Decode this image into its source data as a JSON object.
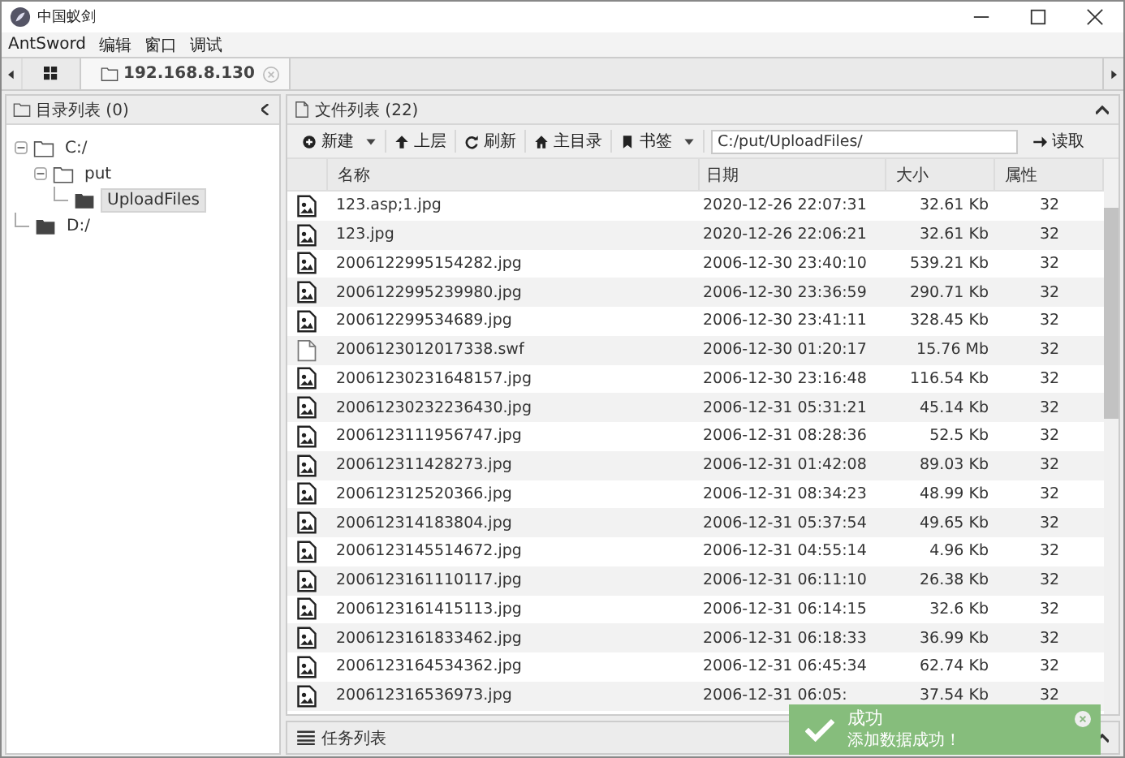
{
  "window": {
    "title": "中国蚁剑"
  },
  "menu": [
    "AntSword",
    "编辑",
    "窗口",
    "调试"
  ],
  "tabs": [
    {
      "label": "192.168.8.130",
      "selected": true
    }
  ],
  "dir_panel": {
    "title": "目录列表 (0)",
    "tree": [
      {
        "label": "C:/",
        "expanded": true,
        "selected": false,
        "children": [
          {
            "label": "put",
            "expanded": true,
            "selected": false,
            "children": [
              {
                "label": "UploadFiles",
                "selected": true
              }
            ]
          }
        ]
      },
      {
        "label": "D:/",
        "selected": false
      }
    ]
  },
  "file_panel": {
    "title": "文件列表 (22)",
    "toolbar": [
      {
        "kind": "new",
        "label": "新建",
        "dropdown": true
      },
      {
        "kind": "up",
        "label": "上层",
        "dropdown": false
      },
      {
        "kind": "refresh",
        "label": "刷新",
        "dropdown": false
      },
      {
        "kind": "home",
        "label": "主目录",
        "dropdown": false
      },
      {
        "kind": "bookmark",
        "label": "书签",
        "dropdown": true
      }
    ],
    "path": "C:/put/UploadFiles/",
    "read_button": "读取",
    "columns": [
      "名称",
      "日期",
      "大小",
      "属性"
    ],
    "rows": [
      {
        "kind": "image",
        "name": "123.asp;1.jpg",
        "date": "2020-12-26 22:07:31",
        "size": "32.61 Kb",
        "attr": "32"
      },
      {
        "kind": "image",
        "name": "123.jpg",
        "date": "2020-12-26 22:06:21",
        "size": "32.61 Kb",
        "attr": "32"
      },
      {
        "kind": "image",
        "name": "2006122995154282.jpg",
        "date": "2006-12-30 23:40:10",
        "size": "539.21 Kb",
        "attr": "32"
      },
      {
        "kind": "image",
        "name": "2006122995239980.jpg",
        "date": "2006-12-30 23:36:59",
        "size": "290.71 Kb",
        "attr": "32"
      },
      {
        "kind": "image",
        "name": "200612299534689.jpg",
        "date": "2006-12-30 23:41:11",
        "size": "328.45 Kb",
        "attr": "32"
      },
      {
        "kind": "file",
        "name": "2006123012017338.swf",
        "date": "2006-12-30 01:20:17",
        "size": "15.76 Mb",
        "attr": "32"
      },
      {
        "kind": "image",
        "name": "20061230231648157.jpg",
        "date": "2006-12-30 23:16:48",
        "size": "116.54 Kb",
        "attr": "32"
      },
      {
        "kind": "image",
        "name": "20061230232236430.jpg",
        "date": "2006-12-31 05:31:21",
        "size": "45.14 Kb",
        "attr": "32"
      },
      {
        "kind": "image",
        "name": "2006123111956747.jpg",
        "date": "2006-12-31 08:28:36",
        "size": "52.5 Kb",
        "attr": "32"
      },
      {
        "kind": "image",
        "name": "200612311428273.jpg",
        "date": "2006-12-31 01:42:08",
        "size": "89.03 Kb",
        "attr": "32"
      },
      {
        "kind": "image",
        "name": "200612312520366.jpg",
        "date": "2006-12-31 08:34:23",
        "size": "48.99 Kb",
        "attr": "32"
      },
      {
        "kind": "image",
        "name": "200612314183804.jpg",
        "date": "2006-12-31 05:37:54",
        "size": "49.65 Kb",
        "attr": "32"
      },
      {
        "kind": "image",
        "name": "2006123145514672.jpg",
        "date": "2006-12-31 04:55:14",
        "size": "4.96 Kb",
        "attr": "32"
      },
      {
        "kind": "image",
        "name": "2006123161110117.jpg",
        "date": "2006-12-31 06:11:10",
        "size": "26.38 Kb",
        "attr": "32"
      },
      {
        "kind": "image",
        "name": "2006123161415113.jpg",
        "date": "2006-12-31 06:14:15",
        "size": "32.6 Kb",
        "attr": "32"
      },
      {
        "kind": "image",
        "name": "2006123161833462.jpg",
        "date": "2006-12-31 06:18:33",
        "size": "36.99 Kb",
        "attr": "32"
      },
      {
        "kind": "image",
        "name": "2006123164534362.jpg",
        "date": "2006-12-31 06:45:34",
        "size": "62.74 Kb",
        "attr": "32"
      },
      {
        "kind": "image",
        "name": "200612316536973.jpg",
        "date": "2006-12-31 06:05:",
        "size": "37.54 Kb",
        "attr": "32"
      }
    ]
  },
  "task_bar": {
    "title": "任务列表"
  },
  "toast": {
    "title": "成功",
    "message": "添加数据成功！"
  }
}
